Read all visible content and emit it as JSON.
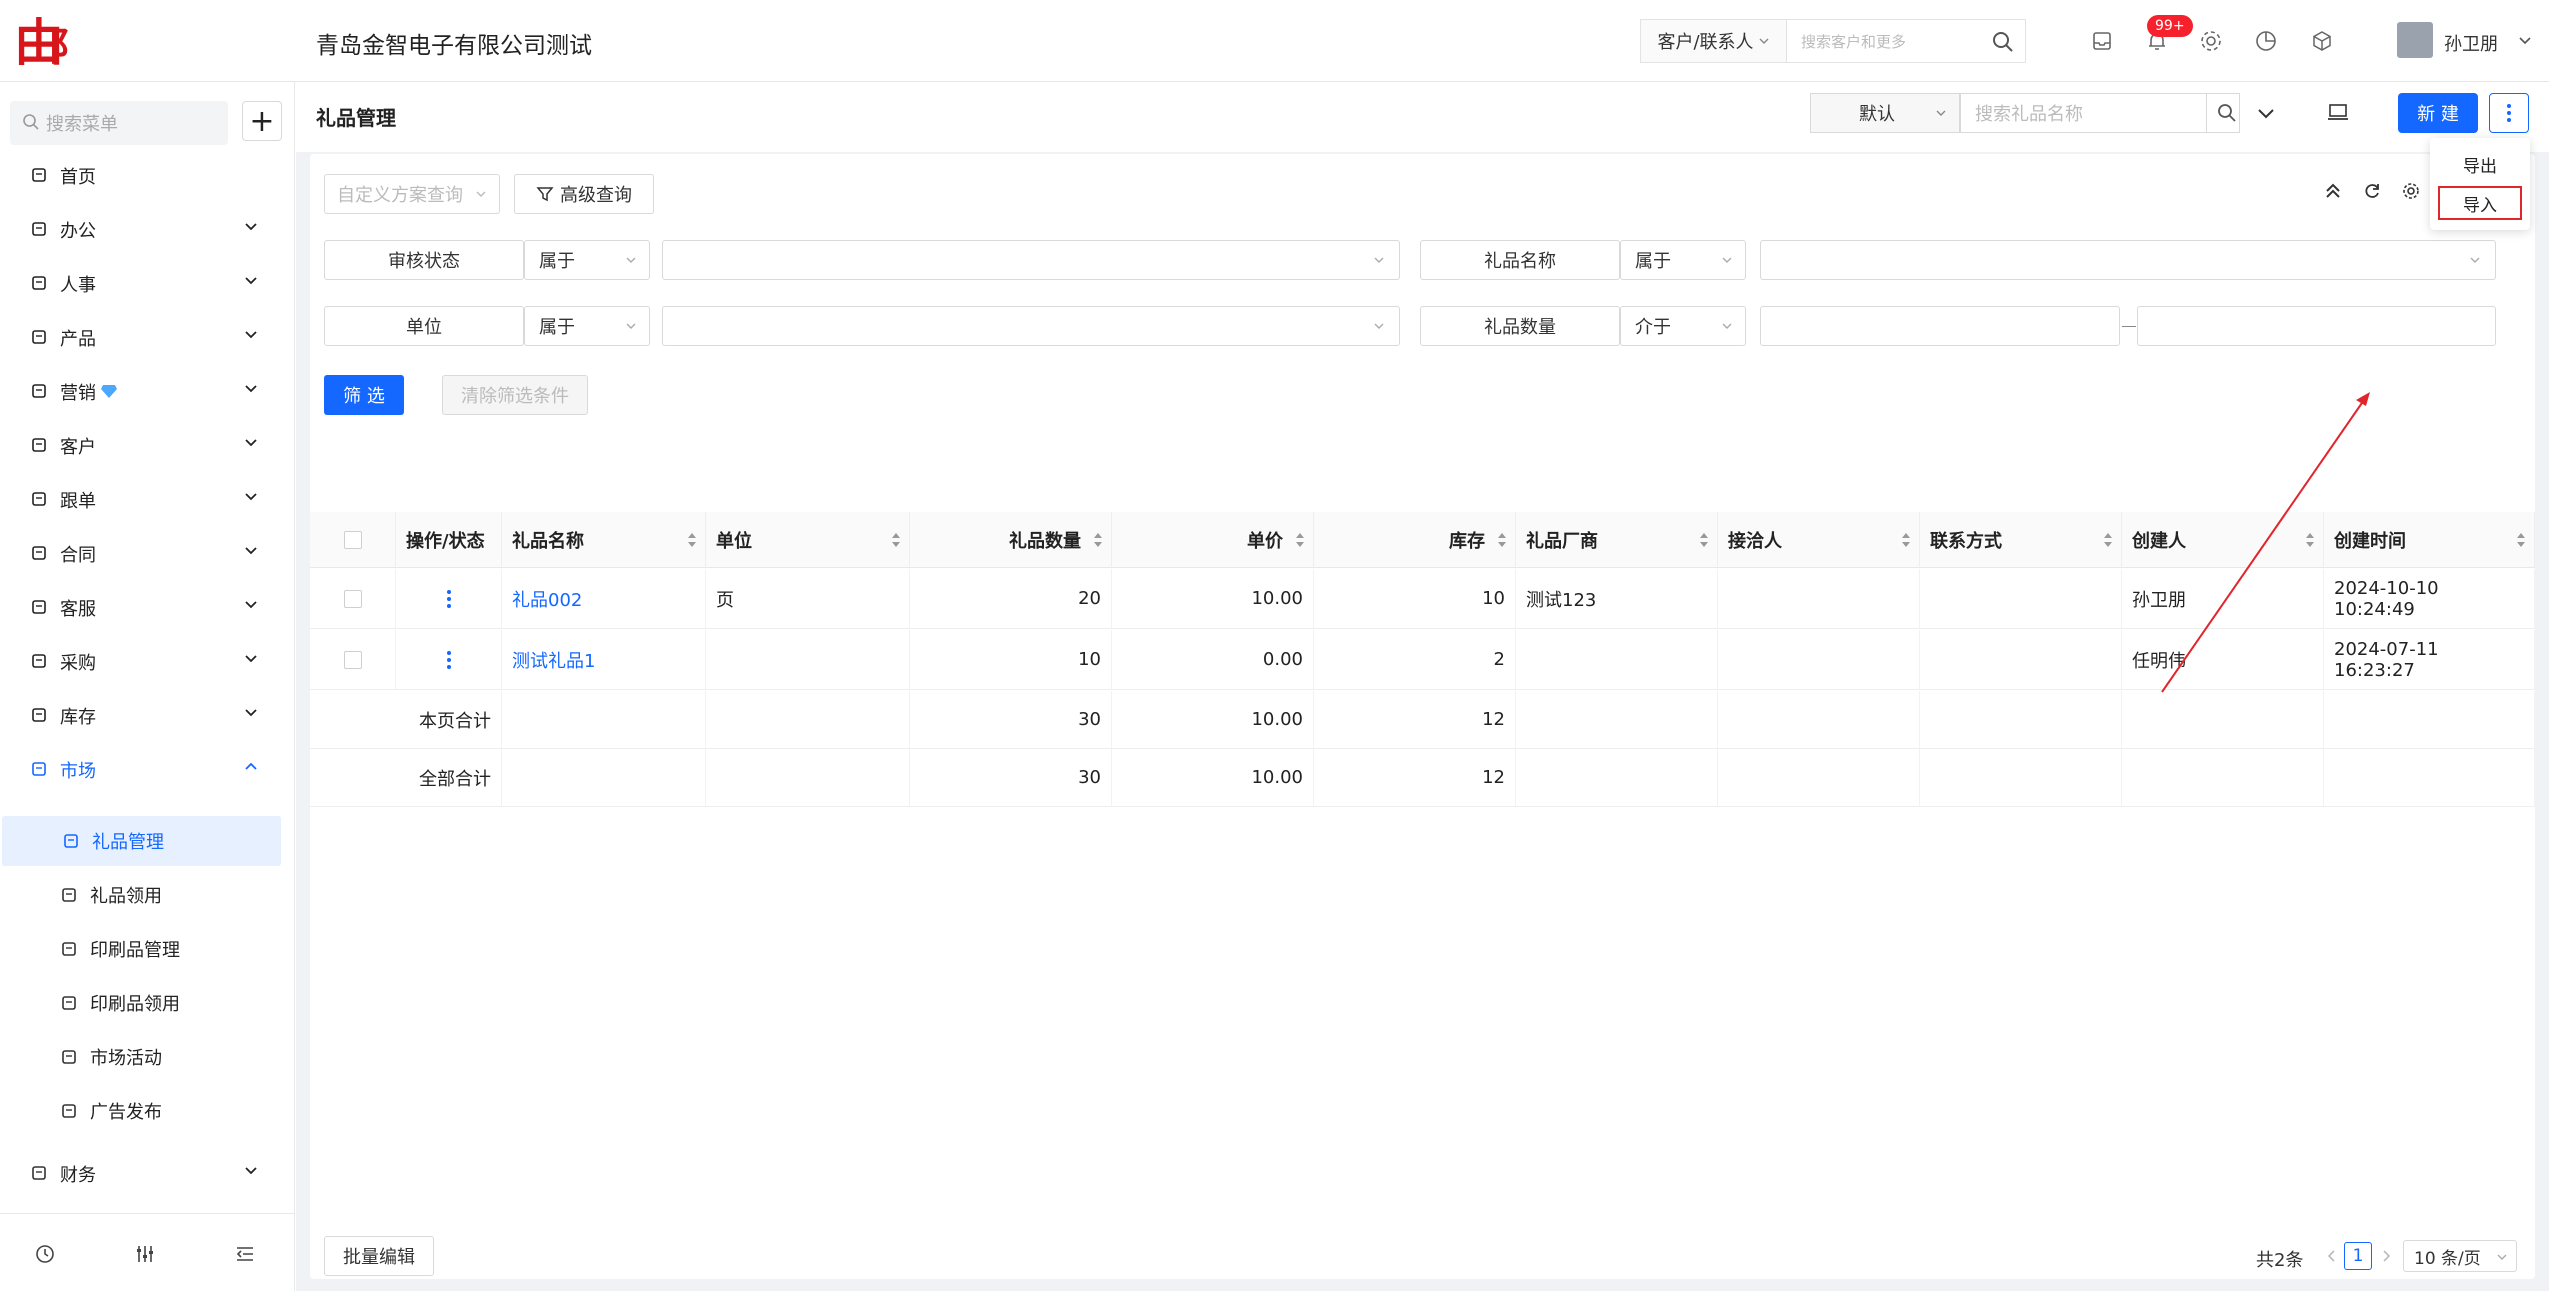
{
  "topbar": {
    "logo_text": "由邮",
    "company": "青岛金智电子有限公司测试",
    "search_type": "客户/联系人",
    "search_placeholder": "搜索客户和更多",
    "notif_badge": "99+",
    "user_name": "孙卫朋"
  },
  "sidebar": {
    "search_placeholder": "搜索菜单",
    "items": [
      {
        "label": "首页",
        "icon": "home-icon"
      },
      {
        "label": "办公",
        "icon": "office-icon"
      },
      {
        "label": "人事",
        "icon": "hr-icon"
      },
      {
        "label": "产品",
        "icon": "product-icon"
      },
      {
        "label": "营销",
        "icon": "marketing-icon"
      },
      {
        "label": "客户",
        "icon": "customer-icon"
      },
      {
        "label": "跟单",
        "icon": "followup-icon"
      },
      {
        "label": "合同",
        "icon": "contract-icon"
      },
      {
        "label": "客服",
        "icon": "service-icon"
      },
      {
        "label": "采购",
        "icon": "purchase-icon"
      },
      {
        "label": "库存",
        "icon": "inventory-icon"
      },
      {
        "label": "市场",
        "icon": "market-icon"
      }
    ],
    "market_sub": [
      {
        "label": "礼品管理",
        "icon": "gift-icon"
      },
      {
        "label": "礼品领用",
        "icon": "gift-icon"
      },
      {
        "label": "印刷品管理",
        "icon": "print-icon"
      },
      {
        "label": "印刷品领用",
        "icon": "print-icon"
      },
      {
        "label": "市场活动",
        "icon": "activity-icon"
      },
      {
        "label": "广告发布",
        "icon": "ad-icon"
      }
    ],
    "finance": "财务"
  },
  "page": {
    "title": "礼品管理",
    "view_select": "默认",
    "search_placeholder": "搜索礼品名称",
    "new_button": "新 建",
    "dropdown": {
      "export": "导出",
      "import": "导入"
    }
  },
  "filters": {
    "scheme_placeholder": "自定义方案查询",
    "advanced": "高级查询",
    "rows": [
      {
        "field": "审核状态",
        "op": "属于"
      },
      {
        "field": "礼品名称",
        "op": "属于"
      },
      {
        "field": "单位",
        "op": "属于"
      },
      {
        "field": "礼品数量",
        "op": "介于"
      }
    ],
    "filter_button": "筛 选",
    "clear_button": "清除筛选条件"
  },
  "table": {
    "headers": [
      "操作/状态",
      "礼品名称",
      "单位",
      "礼品数量",
      "单价",
      "库存",
      "礼品厂商",
      "接洽人",
      "联系方式",
      "创建人",
      "创建时间"
    ],
    "rows": [
      {
        "name": "礼品002",
        "unit": "页",
        "qty": "20",
        "price": "10.00",
        "stock": "10",
        "vendor": "测试123",
        "contact": "",
        "phone": "",
        "creator": "孙卫朋",
        "created": "2024-10-10 10:24:49"
      },
      {
        "name": "测试礼品1",
        "unit": "",
        "qty": "10",
        "price": "0.00",
        "stock": "2",
        "vendor": "",
        "contact": "",
        "phone": "",
        "creator": "任明伟",
        "created": "2024-07-11 16:23:27"
      }
    ],
    "summary": [
      {
        "label": "本页合计",
        "qty": "30",
        "price": "10.00",
        "stock": "12"
      },
      {
        "label": "全部合计",
        "qty": "30",
        "price": "10.00",
        "stock": "12"
      }
    ]
  },
  "footer": {
    "batch_edit": "批量编辑",
    "total": "共2条",
    "page": "1",
    "page_size": "10 条/页"
  },
  "colors": {
    "primary": "#1467ff",
    "highlight": "#e0262d",
    "brand": "#d7161b"
  }
}
